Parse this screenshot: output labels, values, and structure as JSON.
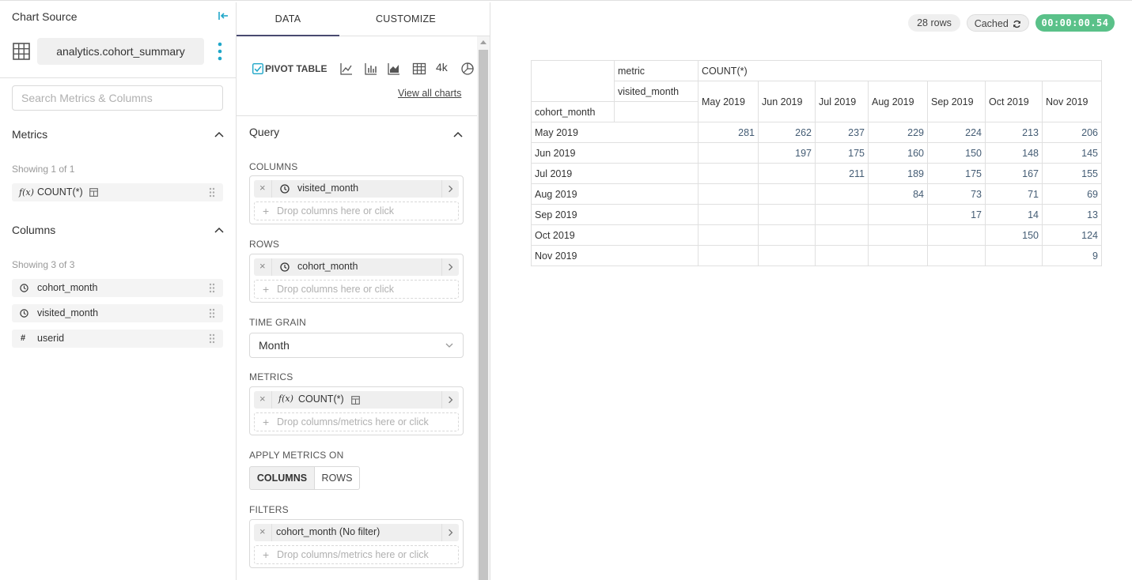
{
  "left_panel": {
    "title": "Chart Source",
    "dataset_name": "analytics.cohort_summary",
    "search_placeholder": "Search Metrics & Columns",
    "metrics": {
      "heading": "Metrics",
      "showing": "Showing 1 of 1",
      "items": [
        {
          "icon": "function-icon",
          "label": "COUNT(*)"
        }
      ]
    },
    "columns": {
      "heading": "Columns",
      "showing": "Showing 3 of 3",
      "items": [
        {
          "icon": "clock-icon",
          "label": "cohort_month"
        },
        {
          "icon": "clock-icon",
          "label": "visited_month"
        },
        {
          "icon": "hash-icon",
          "label": "userid"
        }
      ]
    }
  },
  "middle_panel": {
    "tabs": [
      {
        "label": "DATA",
        "active": true
      },
      {
        "label": "CUSTOMIZE",
        "active": false
      }
    ],
    "viz": {
      "selected_label": "PIVOT TABLE",
      "big_number_label": "4k",
      "view_all": "View all charts"
    },
    "query": {
      "title": "Query",
      "columns": {
        "label": "COLUMNS",
        "pill": "visited_month",
        "drop": "Drop columns here or click"
      },
      "rows": {
        "label": "ROWS",
        "pill": "cohort_month",
        "drop": "Drop columns here or click"
      },
      "time_grain": {
        "label": "TIME GRAIN",
        "value": "Month"
      },
      "metrics": {
        "label": "METRICS",
        "pill": "COUNT(*)",
        "drop": "Drop columns/metrics here or click"
      },
      "apply_metrics_on": {
        "label": "APPLY METRICS ON",
        "options": [
          "COLUMNS",
          "ROWS"
        ],
        "selected": "COLUMNS"
      },
      "filters": {
        "label": "FILTERS",
        "pill": "cohort_month (No filter)",
        "drop": "Drop columns/metrics here or click"
      }
    }
  },
  "right_panel": {
    "row_count": "28 rows",
    "cached": "Cached",
    "timer": "00:00:00.54",
    "pivot": {
      "metric_label": "metric",
      "metric_value": "COUNT(*)",
      "col_dim_label": "visited_month",
      "row_dim_label": "cohort_month",
      "columns": [
        "May 2019",
        "Jun 2019",
        "Jul 2019",
        "Aug 2019",
        "Sep 2019",
        "Oct 2019",
        "Nov 2019"
      ],
      "rows": [
        {
          "label": "May 2019",
          "values": [
            "281",
            "262",
            "237",
            "229",
            "224",
            "213",
            "206"
          ]
        },
        {
          "label": "Jun 2019",
          "values": [
            "",
            "197",
            "175",
            "160",
            "150",
            "148",
            "145"
          ]
        },
        {
          "label": "Jul 2019",
          "values": [
            "",
            "",
            "211",
            "189",
            "175",
            "167",
            "155"
          ]
        },
        {
          "label": "Aug 2019",
          "values": [
            "",
            "",
            "",
            "84",
            "73",
            "71",
            "69"
          ]
        },
        {
          "label": "Sep 2019",
          "values": [
            "",
            "",
            "",
            "",
            "17",
            "14",
            "13"
          ]
        },
        {
          "label": "Oct 2019",
          "values": [
            "",
            "",
            "",
            "",
            "",
            "150",
            "124"
          ]
        },
        {
          "label": "Nov 2019",
          "values": [
            "",
            "",
            "",
            "",
            "",
            "",
            "9"
          ]
        }
      ]
    }
  },
  "colors": {
    "accent": "#20a7c9",
    "tab_underline": "#484a70",
    "timer_bg": "#5ac189"
  }
}
